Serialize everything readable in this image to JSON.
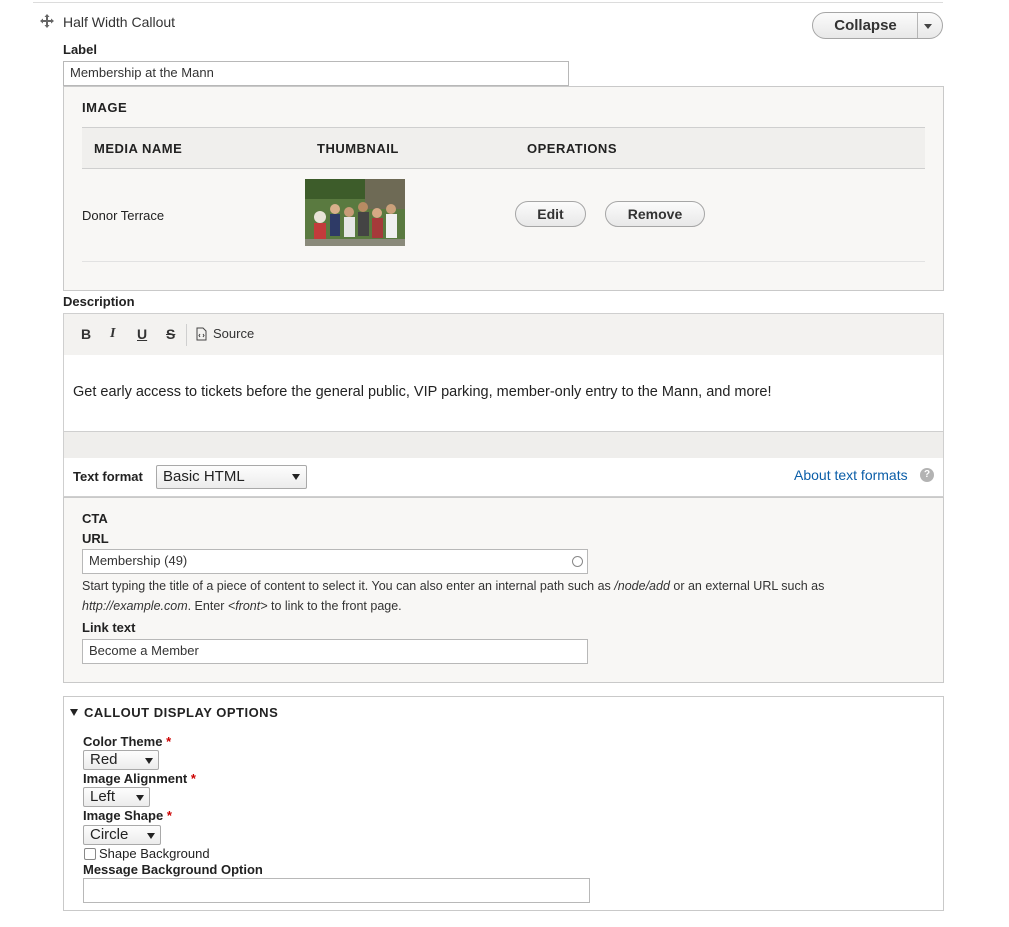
{
  "paragraph": {
    "title": "Half Width Callout",
    "collapse_label": "Collapse"
  },
  "label_field": {
    "label": "Label",
    "value": "Membership at the Mann"
  },
  "image": {
    "legend": "IMAGE",
    "columns": [
      "MEDIA NAME",
      "THUMBNAIL",
      "OPERATIONS"
    ],
    "rows": [
      {
        "media_name": "Donor Terrace",
        "edit_label": "Edit",
        "remove_label": "Remove"
      }
    ]
  },
  "description": {
    "label": "Description",
    "toolbar": {
      "bold": "B",
      "italic": "I",
      "underline": "U",
      "strike": "S",
      "source": "Source"
    },
    "body": "Get early access to tickets before the general public, VIP parking, member-only entry to the Mann, and more!",
    "text_format_label": "Text format",
    "text_format_value": "Basic HTML",
    "about_link": "About text formats"
  },
  "cta": {
    "legend": "CTA",
    "url_label": "URL",
    "url_value": "Membership (49)",
    "help_1a": "Start typing the title of a piece of content to select it. You can also enter an internal path such as ",
    "help_1b": "/node/add",
    "help_1c": " or an external URL such as",
    "help_2a": "http://example.com",
    "help_2b": ". Enter ",
    "help_2c": "<front>",
    "help_2d": " to link to the front page.",
    "link_text_label": "Link text",
    "link_text_value": "Become a Member"
  },
  "display": {
    "legend": "CALLOUT DISPLAY OPTIONS",
    "color_theme_label": "Color Theme",
    "color_theme_value": "Red",
    "image_alignment_label": "Image Alignment",
    "image_alignment_value": "Left",
    "image_shape_label": "Image Shape",
    "image_shape_value": "Circle",
    "shape_background_label": "Shape Background",
    "shape_background_checked": false,
    "message_bg_label": "Message Background Option",
    "message_bg_value": "",
    "required_mark": "*"
  },
  "colors": {
    "link": "#0b5ea8",
    "required": "#cc0000"
  }
}
